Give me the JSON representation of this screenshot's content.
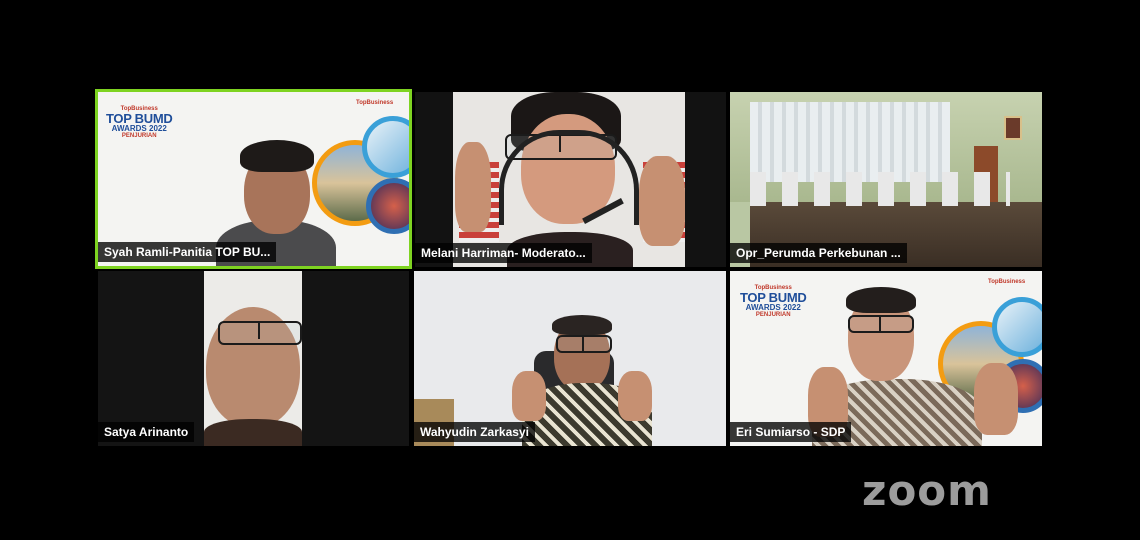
{
  "app": {
    "logo_text": "zoom"
  },
  "colors": {
    "active_speaker_border": "#7ed321",
    "background": "#000000",
    "name_tag_bg": "rgba(0,0,0,0.78)",
    "award_blue": "#1f4e9a",
    "award_red": "#c0392b",
    "award_orange": "#f39c12"
  },
  "award": {
    "brand": "TopBusiness",
    "title": "TOP BUMD",
    "year_line": "AWARDS 2022",
    "sub": "PENJURIAN"
  },
  "participants": [
    {
      "name": "Syah Ramli-Panitia TOP BU...",
      "active": true
    },
    {
      "name": "Melani Harriman- Moderato..."
    },
    {
      "name": "Opr_Perumda Perkebunan ..."
    },
    {
      "name": "Satya Arinanto"
    },
    {
      "name": "Wahyudin Zarkasyi"
    },
    {
      "name": "Eri Sumiarso - SDP"
    }
  ]
}
